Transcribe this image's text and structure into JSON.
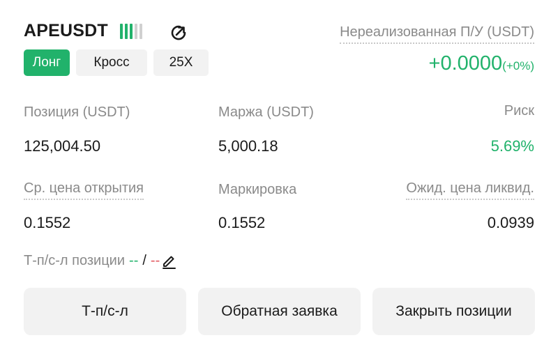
{
  "header": {
    "symbol": "APEUSDT",
    "signal_bars": {
      "filled": 3,
      "total": 5
    },
    "share_icon": "share-arrow-icon",
    "tags": {
      "side": "Лонг",
      "margin_mode": "Кросс",
      "leverage": "25X"
    },
    "unrealized_pnl": {
      "label": "Нереализованная П/У (USDT)",
      "value": "+0.0000",
      "percent": "(+0%)"
    }
  },
  "stats": {
    "position": {
      "label": "Позиция (USDT)",
      "value": "125,004.50"
    },
    "margin": {
      "label": "Маржа (USDT)",
      "value": "5,000.18"
    },
    "risk": {
      "label": "Риск",
      "value": "5.69%"
    },
    "avg_entry": {
      "label": "Ср. цена открытия",
      "value": "0.1552"
    },
    "mark_price": {
      "label": "Маркировка",
      "value": "0.1552"
    },
    "liq_price": {
      "label": "Ожид. цена ликвид.",
      "value": "0.0939"
    }
  },
  "tpsl": {
    "label": "Т-п/с-л позиции",
    "tp": "--",
    "separator": "/",
    "sl": "--",
    "edit_icon": "pencil-icon"
  },
  "buttons": {
    "tpsl": "Т-п/с-л",
    "reverse": "Обратная заявка",
    "close": "Закрыть позиции"
  },
  "colors": {
    "green": "#21b26b",
    "red": "#e2585f",
    "bar_empty": "#d0d0d0"
  }
}
